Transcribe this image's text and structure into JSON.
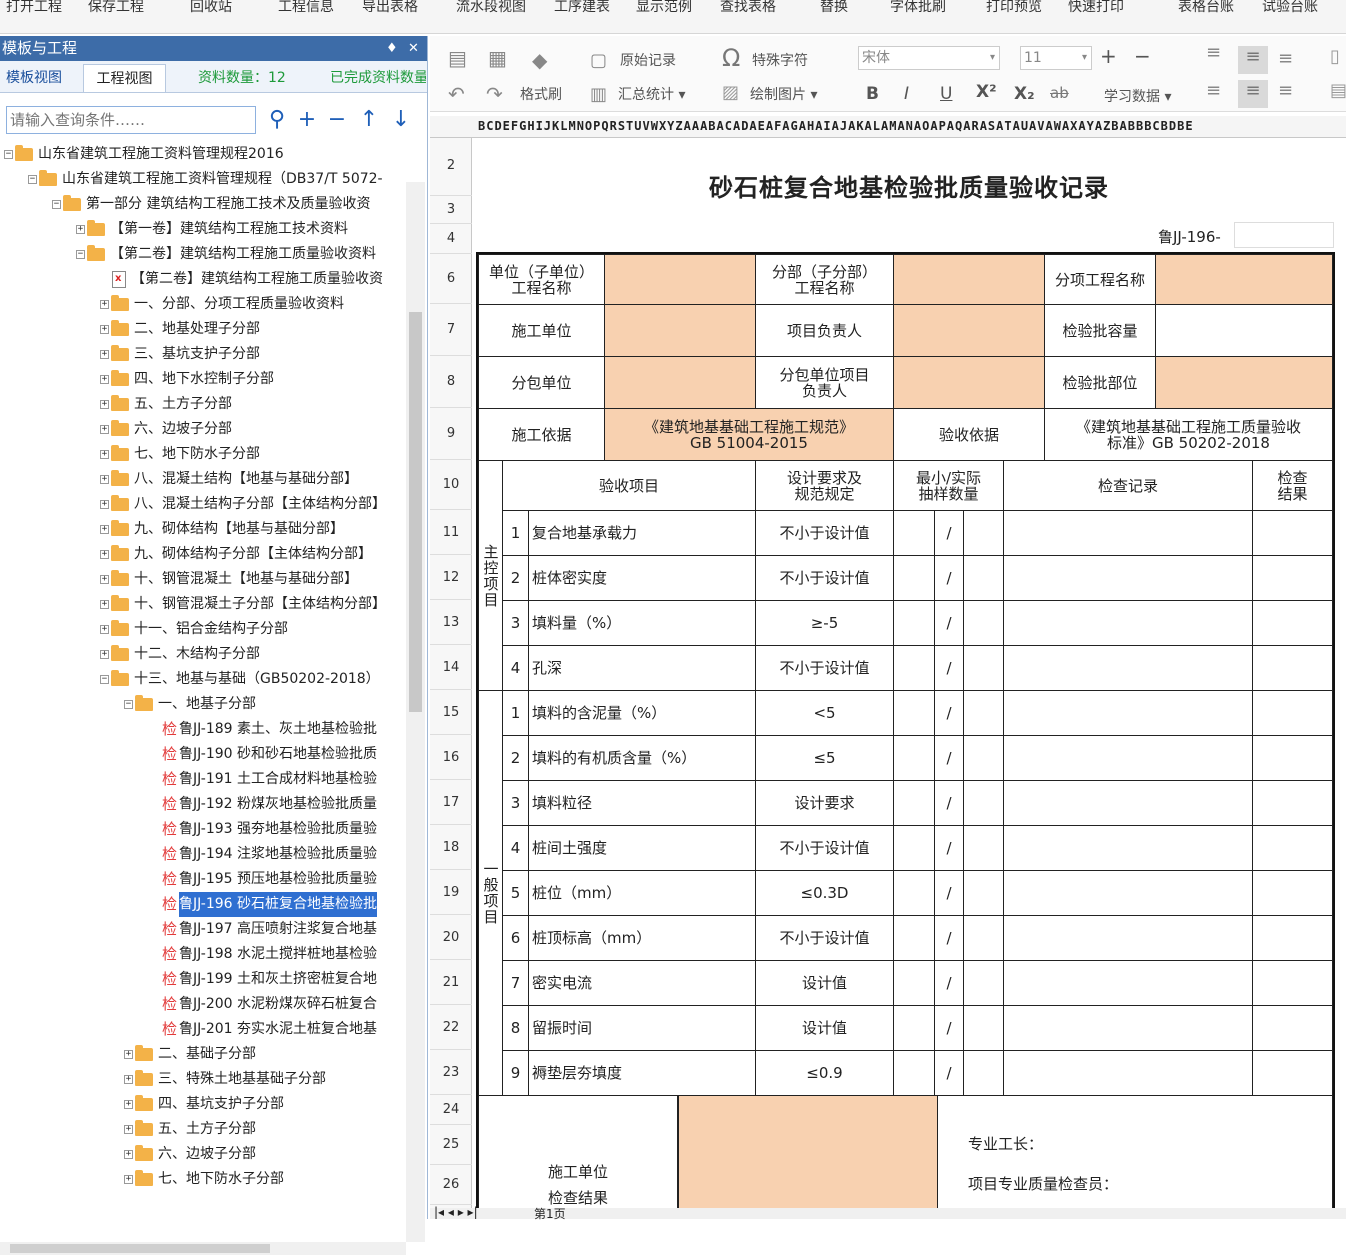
{
  "menu": [
    "打开工程",
    "保存工程",
    "回收站",
    "工程信息",
    "导出表格",
    "流水段视图",
    "工序建表",
    "显示范例",
    "查找表格",
    "替换",
    "字体批刷",
    "打印预览",
    "快速打印",
    "表格台账",
    "试验台账"
  ],
  "panel": {
    "title": "模板与工程",
    "pin": "♦",
    "close": "✕",
    "tab_template": "模板视图",
    "tab_project": "工程视图",
    "count": "资料数量：12",
    "completed": "已完成资料数量",
    "search_placeholder": "请输入查询条件……"
  },
  "tree": [
    {
      "label": "山东省建筑工程施工资料管理规程2016",
      "exp": "−",
      "icon": "folder"
    },
    {
      "label": "山东省建筑工程施工资料管理规程（DB37/T 5072-",
      "exp": "−",
      "icon": "folder"
    },
    {
      "label": "第一部分  建筑结构工程施工技术及质量验收资",
      "exp": "−",
      "icon": "folder"
    },
    {
      "label": "【第一卷】建筑结构工程施工技术资料",
      "exp": "+",
      "icon": "folder"
    },
    {
      "label": "【第二卷】建筑结构工程施工质量验收资料",
      "exp": "−",
      "icon": "folder"
    },
    {
      "label": "【第二卷】建筑结构工程施工质量验收资",
      "exp": "",
      "icon": "doc"
    },
    {
      "label": "一、分部、分项工程质量验收资料",
      "exp": "+",
      "icon": "folder"
    },
    {
      "label": "二、地基处理子分部",
      "exp": "+",
      "icon": "folder"
    },
    {
      "label": "三、基坑支护子分部",
      "exp": "+",
      "icon": "folder"
    },
    {
      "label": "四、地下水控制子分部",
      "exp": "+",
      "icon": "folder"
    },
    {
      "label": "五、土方子分部",
      "exp": "+",
      "icon": "folder"
    },
    {
      "label": "六、边坡子分部",
      "exp": "+",
      "icon": "folder"
    },
    {
      "label": "七、地下防水子分部",
      "exp": "+",
      "icon": "folder"
    },
    {
      "label": "八、混凝土结构【地基与基础分部】",
      "exp": "+",
      "icon": "folder"
    },
    {
      "label": "八、混凝土结构子分部【主体结构分部】",
      "exp": "+",
      "icon": "folder"
    },
    {
      "label": "九、砌体结构【地基与基础分部】",
      "exp": "+",
      "icon": "folder"
    },
    {
      "label": "九、砌体结构子分部【主体结构分部】",
      "exp": "+",
      "icon": "folder"
    },
    {
      "label": "十、钢管混凝土【地基与基础分部】",
      "exp": "+",
      "icon": "folder"
    },
    {
      "label": "十、钢管混凝土子分部【主体结构分部】",
      "exp": "+",
      "icon": "folder"
    },
    {
      "label": "十一、铝合金结构子分部",
      "exp": "+",
      "icon": "folder"
    },
    {
      "label": "十二、木结构子分部",
      "exp": "+",
      "icon": "folder"
    },
    {
      "label": "十三、地基与基础（GB50202-2018）",
      "exp": "−",
      "icon": "folder"
    },
    {
      "label": "一、地基子分部",
      "exp": "−",
      "icon": "folder"
    },
    {
      "label": "鲁JJ-189 素土、灰土地基检验批",
      "exp": "",
      "icon": "jian"
    },
    {
      "label": "鲁JJ-190 砂和砂石地基检验批质",
      "exp": "",
      "icon": "jian"
    },
    {
      "label": "鲁JJ-191 土工合成材料地基检验",
      "exp": "",
      "icon": "jian"
    },
    {
      "label": "鲁JJ-192 粉煤灰地基检验批质量",
      "exp": "",
      "icon": "jian"
    },
    {
      "label": "鲁JJ-193 强夯地基检验批质量验",
      "exp": "",
      "icon": "jian"
    },
    {
      "label": "鲁JJ-194 注浆地基检验批质量验",
      "exp": "",
      "icon": "jian"
    },
    {
      "label": "鲁JJ-195 预压地基检验批质量验",
      "exp": "",
      "icon": "jian"
    },
    {
      "label": "鲁JJ-196 砂石桩复合地基检验批",
      "exp": "",
      "icon": "jian",
      "selected": true
    },
    {
      "label": "鲁JJ-197 高压喷射注浆复合地基",
      "exp": "",
      "icon": "jian"
    },
    {
      "label": "鲁JJ-198 水泥土搅拌桩地基检验",
      "exp": "",
      "icon": "jian"
    },
    {
      "label": "鲁JJ-199 土和灰土挤密桩复合地",
      "exp": "",
      "icon": "jian"
    },
    {
      "label": "鲁JJ-200 水泥粉煤灰碎石桩复合",
      "exp": "",
      "icon": "jian"
    },
    {
      "label": "鲁JJ-201 夯实水泥土桩复合地基",
      "exp": "",
      "icon": "jian"
    },
    {
      "label": "二、基础子分部",
      "exp": "+",
      "icon": "folder"
    },
    {
      "label": "三、特殊土地基基础子分部",
      "exp": "+",
      "icon": "folder"
    },
    {
      "label": "四、基坑支护子分部",
      "exp": "+",
      "icon": "folder"
    },
    {
      "label": "五、土方子分部",
      "exp": "+",
      "icon": "folder"
    },
    {
      "label": "六、边坡子分部",
      "exp": "+",
      "icon": "folder"
    },
    {
      "label": "七、地下防水子分部",
      "exp": "+",
      "icon": "folder"
    }
  ],
  "toolbar": {
    "record": "原始记录",
    "special": "特殊字符",
    "brush": "格式刷",
    "summary": "汇总统计 ▾",
    "draw": "绘制图片 ▾",
    "font": "宋体",
    "size": "11",
    "bold": "B",
    "italic": "I",
    "underline": "U",
    "sup": "X²",
    "sub": "X₂",
    "strike": "ab",
    "learn": "学习数据 ▾",
    "plus": "+",
    "minus": "−"
  },
  "columns": "BCDEFGHIJKLMNOPQRSTUVWXYZAAABACADAEAFAGAHAIAJAKALAMANAOAPAQARASATAUAVAWAXAYAZBABBBCBDBE",
  "rows": [
    "2",
    "3",
    "4",
    "6",
    "7",
    "8",
    "9",
    "10",
    "11",
    "12",
    "13",
    "14",
    "15",
    "16",
    "17",
    "18",
    "19",
    "20",
    "21",
    "22",
    "23",
    "24",
    "25",
    "26"
  ],
  "form": {
    "title": "砂石桩复合地基检验批质量验收记录",
    "code": "鲁JJ-196-",
    "unit_name": "单位（子单位）\n工程名称",
    "sub_name": "分部（子分部）\n工程名称",
    "item_name": "分项工程名称",
    "contractor": "施工单位",
    "pm": "项目负责人",
    "batch_cap": "检验批容量",
    "subcontractor": "分包单位",
    "sub_pm": "分包单位项目\n负责人",
    "batch_loc": "检验批部位",
    "basis": "施工依据",
    "basis_val": "《建筑地基基础工程施工规范》\nGB 51004-2015",
    "accept_basis": "验收依据",
    "accept_val": "《建筑地基基础工程施工质量验收\n标准》GB 50202-2018",
    "h_item": "验收项目",
    "h_req": "设计要求及\n规范规定",
    "h_sample": "最小/实际\n抽样数量",
    "h_record": "检查记录",
    "h_result": "检查\n结果",
    "main_label": "主控项目",
    "general_label": "一般项目",
    "main_items": [
      {
        "n": "1",
        "name": "复合地基承载力",
        "req": "不小于设计值"
      },
      {
        "n": "2",
        "name": "桩体密实度",
        "req": "不小于设计值"
      },
      {
        "n": "3",
        "name": "填料量（%）",
        "req": "≥-5"
      },
      {
        "n": "4",
        "name": "孔深",
        "req": "不小于设计值"
      }
    ],
    "general_items": [
      {
        "n": "1",
        "name": "填料的含泥量（%）",
        "req": "<5"
      },
      {
        "n": "2",
        "name": "填料的有机质含量（%）",
        "req": "≤5"
      },
      {
        "n": "3",
        "name": "填料粒径",
        "req": "设计要求"
      },
      {
        "n": "4",
        "name": "桩间土强度",
        "req": "不小于设计值"
      },
      {
        "n": "5",
        "name": "桩位（mm）",
        "req": "≤0.3D"
      },
      {
        "n": "6",
        "name": "桩顶标高（mm）",
        "req": "不小于设计值"
      },
      {
        "n": "7",
        "name": "密实电流",
        "req": "设计值"
      },
      {
        "n": "8",
        "name": "留振时间",
        "req": "设计值"
      },
      {
        "n": "9",
        "name": "褥垫层夯填度",
        "req": "≤0.9"
      }
    ],
    "slash": "/",
    "check_unit": "施工单位\n检查结果",
    "foreman": "专业工长：",
    "inspector": "项目专业质量检查员："
  },
  "sheet_tab": "第1页"
}
